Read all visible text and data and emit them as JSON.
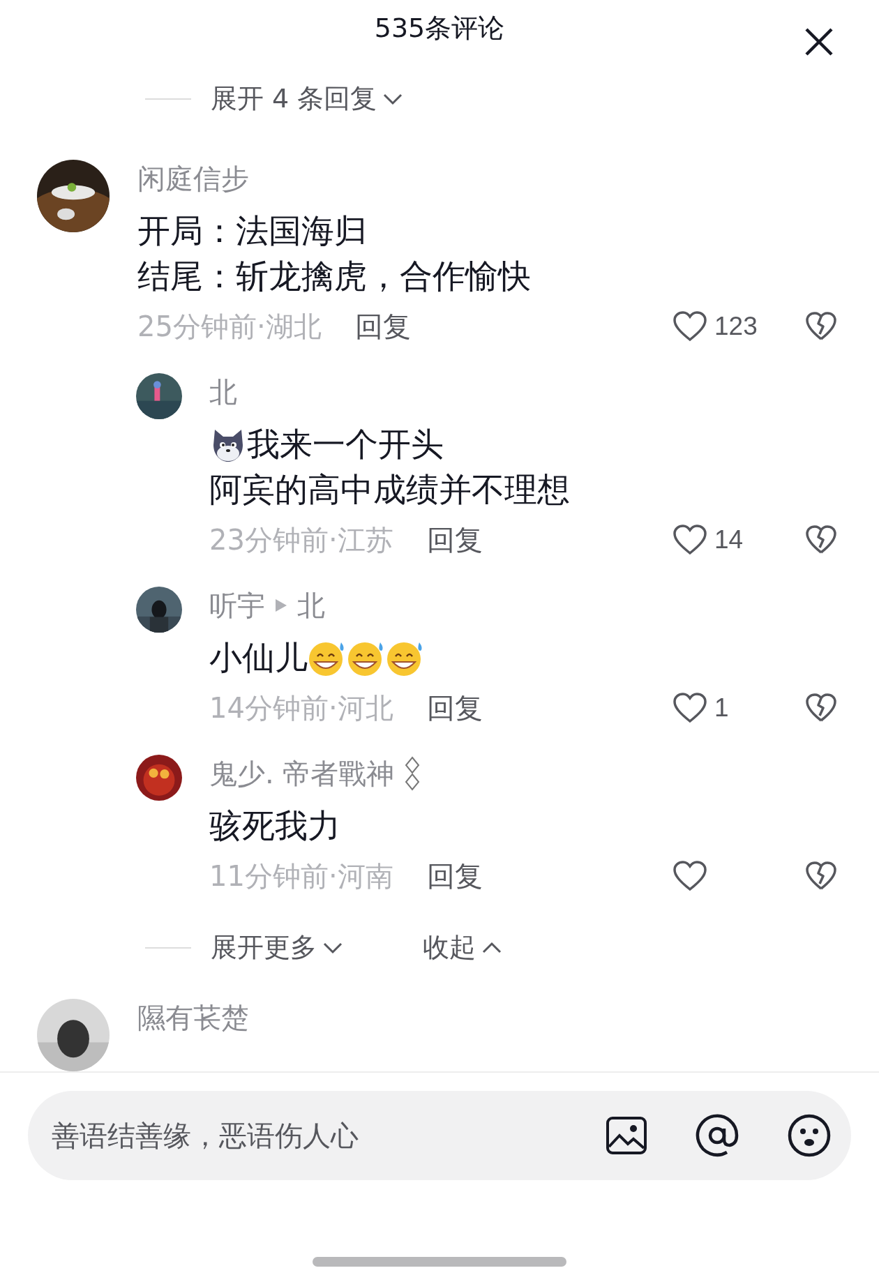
{
  "header": {
    "title": "535条评论"
  },
  "top_expand": {
    "label": "展开 4 条回复"
  },
  "comment": {
    "user": "闲庭信步",
    "lines": [
      [
        {
          "kind": "text",
          "text": "开局：法国海归"
        }
      ],
      [
        {
          "kind": "text",
          "text": "结尾：斩龙擒虎，合作愉快"
        }
      ]
    ],
    "meta": "25分钟前·湖北",
    "reply": "回复",
    "likes": "123",
    "replies": [
      {
        "user": "北",
        "lines": [
          [
            {
              "kind": "dog"
            },
            {
              "kind": "text",
              "text": "我来一个开头"
            }
          ],
          [
            {
              "kind": "text",
              "text": "阿宾的高中成绩并不理想"
            }
          ]
        ],
        "meta": "23分钟前·江苏",
        "reply": "回复",
        "likes": "14",
        "badge": false
      },
      {
        "user": "听宇",
        "reply_to": "北",
        "lines": [
          [
            {
              "kind": "text",
              "text": "小仙儿"
            },
            {
              "kind": "grin"
            },
            {
              "kind": "grin"
            },
            {
              "kind": "grin"
            }
          ]
        ],
        "meta": "14分钟前·河北",
        "reply": "回复",
        "likes": "1",
        "badge": false
      },
      {
        "user": "鬼少. 帝者戰神",
        "lines": [
          [
            {
              "kind": "text",
              "text": "骇死我力"
            }
          ]
        ],
        "meta": "11分钟前·河南",
        "reply": "回复",
        "badge": true
      }
    ]
  },
  "more": {
    "expand": "展开更多",
    "collapse": "收起"
  },
  "next_comment": {
    "user": "隰有苌楚"
  },
  "composer": {
    "placeholder": "善语结善缘，恶语伤人心"
  }
}
